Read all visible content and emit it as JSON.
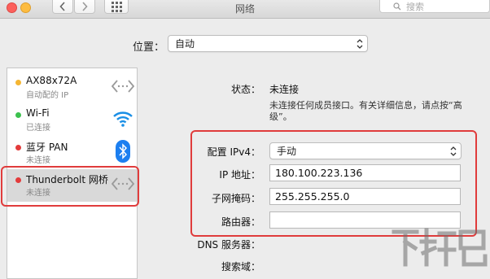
{
  "window": {
    "title": "网络",
    "search_placeholder": "搜索"
  },
  "location": {
    "label": "位置：",
    "value": "自动"
  },
  "services": [
    {
      "name": "AX88x72A",
      "status": "自动配的 IP",
      "dot_color": "#f5b633",
      "icon": "ethernet-arrows-icon"
    },
    {
      "name": "Wi-Fi",
      "status": "已连接",
      "dot_color": "#3cc14e",
      "icon": "wifi-icon"
    },
    {
      "name": "蓝牙 PAN",
      "status": "未连接",
      "dot_color": "#e33b3b",
      "icon": "bluetooth-icon"
    },
    {
      "name": "Thunderbolt 网桥",
      "status": "未连接",
      "dot_color": "#e33b3b",
      "icon": "ethernet-arrows-icon"
    }
  ],
  "detail": {
    "status_label": "状态：",
    "status_value": "未连接",
    "status_desc_line1": "未连接任何成员接口。有关详细信息，请点按“高",
    "status_desc_line2": "级”。",
    "configure_ipv4_label": "配置 IPv4：",
    "configure_ipv4_value": "手动",
    "ip_label": "IP 地址：",
    "ip_value": "180.100.223.136",
    "subnet_label": "子网掩码：",
    "subnet_value": "255.255.255.0",
    "router_label": "路由器：",
    "router_value": "",
    "dns_label": "DNS 服务器：",
    "search_domain_label": "搜索域："
  },
  "colors": {
    "highlight_box": "#e03c3c",
    "selected_row": "#d9d9d9",
    "wifi_blue": "#1a8fe6",
    "bluetooth_blue": "#1c7ff0"
  },
  "watermark": {
    "text": "下载吧"
  }
}
